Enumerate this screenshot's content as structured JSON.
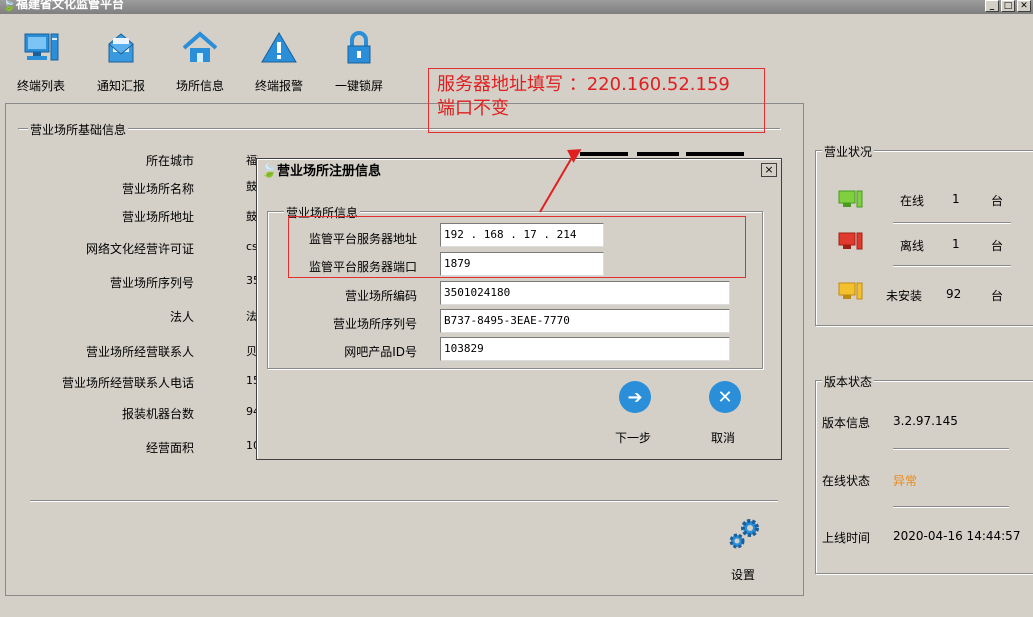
{
  "window": {
    "title": "福建省文化监管平台"
  },
  "toolbar": [
    {
      "label": "终端列表",
      "icon": "computer-icon"
    },
    {
      "label": "通知汇报",
      "icon": "envelope-icon"
    },
    {
      "label": "场所信息",
      "icon": "home-icon"
    },
    {
      "label": "终端报警",
      "icon": "warning-icon"
    },
    {
      "label": "一键锁屏",
      "icon": "lock-icon"
    }
  ],
  "callout": {
    "line1": "服务器地址填写 ：220.160.52.159",
    "line2": "端口不变"
  },
  "basic_info": {
    "title": "营业场所基础信息",
    "fields": [
      {
        "label": "所在城市",
        "value": "福建省 福州市 鼓楼区"
      },
      {
        "label": "营业场所名称",
        "value": "鼓"
      },
      {
        "label": "营业场所地址",
        "value": "鼓"
      },
      {
        "label": "网络文化经营许可证",
        "value": "cs"
      },
      {
        "label": "营业场所序列号",
        "value": "35"
      },
      {
        "label": "法人",
        "value": "法"
      },
      {
        "label": "营业场所经营联系人",
        "value": "贝"
      },
      {
        "label": "营业场所经营联系人电话",
        "value": "15"
      },
      {
        "label": "报装机器台数",
        "value": "94"
      },
      {
        "label": "经营面积",
        "value": "10"
      }
    ],
    "settings_label": "设置"
  },
  "dialog": {
    "title": "营业场所注册信息",
    "close": "×",
    "group_title": "营业场所信息",
    "server_addr": {
      "label": "监管平台服务器地址",
      "value": "192 . 168 . 17 . 214"
    },
    "server_port": {
      "label": "监管平台服务器端口",
      "value": "1879"
    },
    "venue_code": {
      "label": "营业场所编码",
      "value": "3501024180"
    },
    "venue_serial": {
      "label": "营业场所序列号",
      "value": "B737-8495-3EAE-7770"
    },
    "product_id": {
      "label": "网吧产品ID号",
      "value": "103829"
    },
    "next_label": "下一步",
    "cancel_label": "取消"
  },
  "business_status": {
    "title": "营业状况",
    "rows": [
      {
        "label": "在线",
        "count": "1",
        "unit": "台",
        "color": "#7fcf3f"
      },
      {
        "label": "离线",
        "count": "1",
        "unit": "台",
        "color": "#e03a2e"
      },
      {
        "label": "未安装",
        "count": "92",
        "unit": "台",
        "color": "#f4c02e"
      }
    ]
  },
  "version_status": {
    "title": "版本状态",
    "version_label": "版本信息",
    "version_value": "3.2.97.145",
    "online_label": "在线状态",
    "online_value": "异常",
    "online_color": "#e88a1a",
    "uptime_label": "上线时间",
    "uptime_value": "2020-04-16 14:44:57"
  }
}
